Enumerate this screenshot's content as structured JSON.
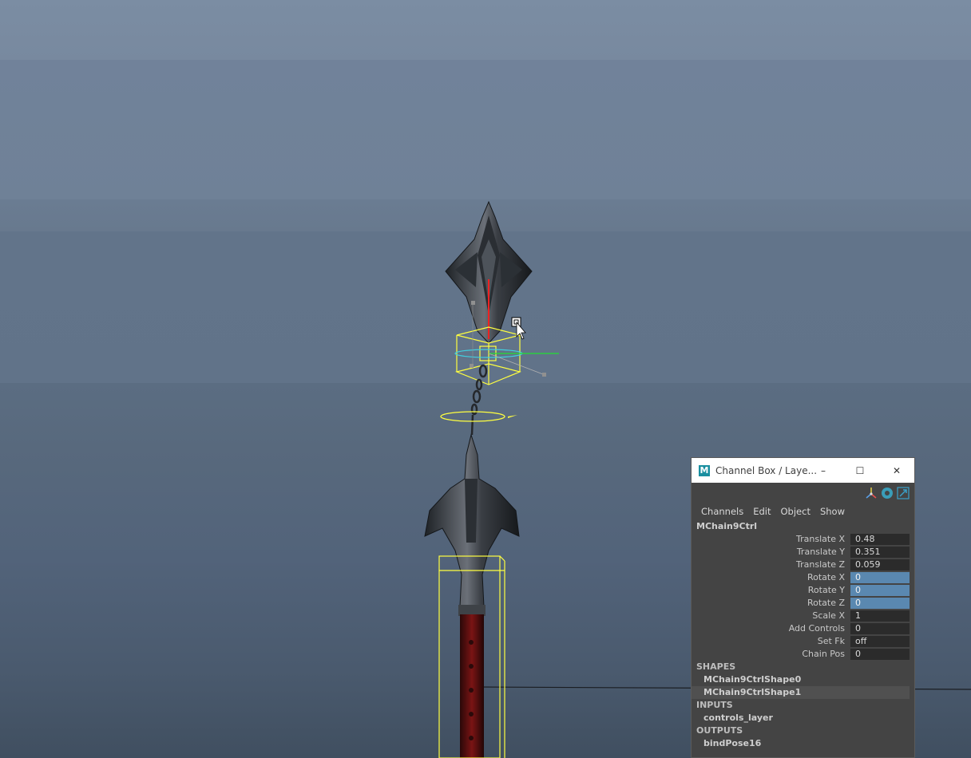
{
  "window": {
    "title": "Channel Box / Laye...",
    "logo_letter": "M",
    "minimize_glyph": "–",
    "maximize_glyph": "☐",
    "close_glyph": "✕"
  },
  "toolbar_icons": [
    "axis-icon",
    "key-icon",
    "link-icon"
  ],
  "menus": [
    "Channels",
    "Edit",
    "Object",
    "Show"
  ],
  "object_name": "MChain9Ctrl",
  "attributes": [
    {
      "label": "Translate X",
      "value": "0.48",
      "keyed": false
    },
    {
      "label": "Translate Y",
      "value": "0.351",
      "keyed": false
    },
    {
      "label": "Translate Z",
      "value": "0.059",
      "keyed": false
    },
    {
      "label": "Rotate X",
      "value": "0",
      "keyed": true
    },
    {
      "label": "Rotate Y",
      "value": "0",
      "keyed": true
    },
    {
      "label": "Rotate Z",
      "value": "0",
      "keyed": true
    },
    {
      "label": "Scale X",
      "value": "1",
      "keyed": false
    },
    {
      "label": "Add Controls",
      "value": "0",
      "keyed": false
    },
    {
      "label": "Set Fk",
      "value": "off",
      "keyed": false
    },
    {
      "label": "Chain Pos",
      "value": "0",
      "keyed": false
    }
  ],
  "shapes": {
    "header": "SHAPES",
    "items": [
      "MChain9CtrlShape0",
      "MChain9CtrlShape1"
    ]
  },
  "inputs": {
    "header": "INPUTS",
    "items": [
      "controls_layer"
    ]
  },
  "outputs": {
    "header": "OUTPUTS",
    "items": [
      "bindPose16"
    ]
  },
  "colors": {
    "selection": "#ffff40",
    "manip_green": "#22dd33",
    "manip_red": "#ee2222",
    "manip_cyan": "#40d0e0",
    "keyed_field": "#5a88b0"
  }
}
